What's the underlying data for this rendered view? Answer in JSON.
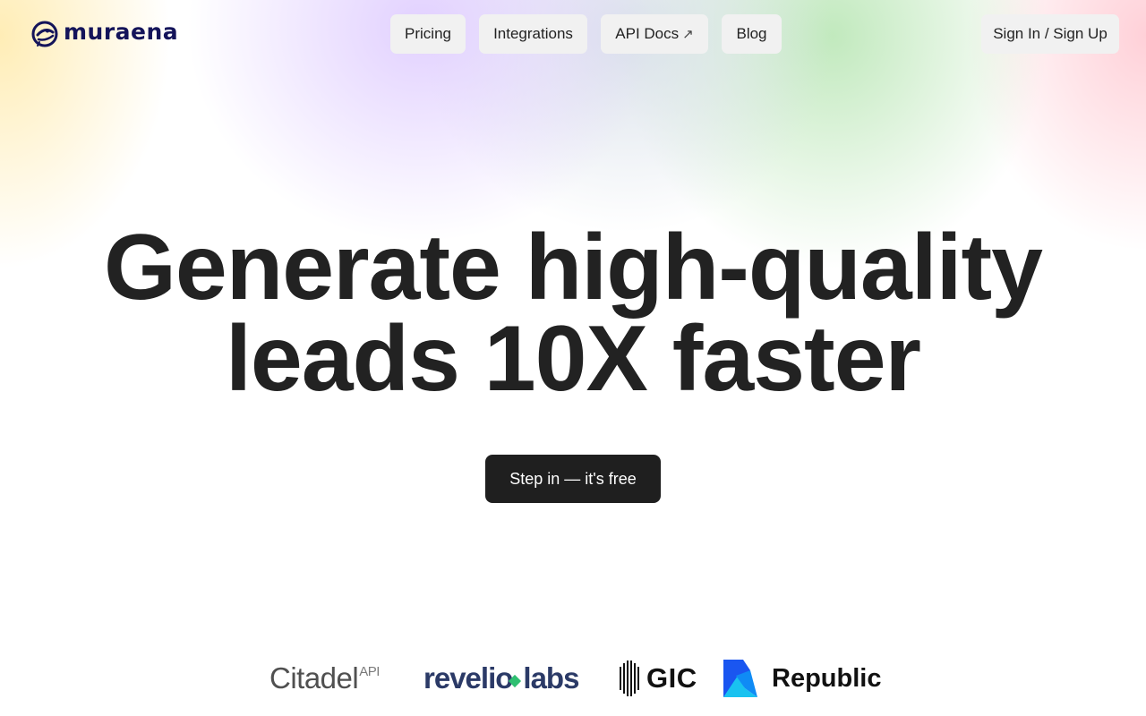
{
  "brand": {
    "name": "muraena",
    "color": "#14145a"
  },
  "nav": {
    "pricing": "Pricing",
    "integrations": "Integrations",
    "api_docs": "API Docs",
    "api_docs_icon": "external-arrow-icon",
    "blog": "Blog",
    "signin": "Sign In / Sign Up"
  },
  "hero": {
    "line1": "Generate high-quality",
    "line2": "leads 10X faster",
    "cta": "Step in — it's free"
  },
  "partners": {
    "citadel": "Citadel",
    "citadel_sup": "API",
    "revelio_a": "revelio",
    "revelio_b": "labs",
    "gic": "GIC",
    "republic": "Republic"
  },
  "colors": {
    "cta_bg": "#1f1f1f",
    "nav_bg": "#f1f1f1",
    "text": "#222222"
  }
}
